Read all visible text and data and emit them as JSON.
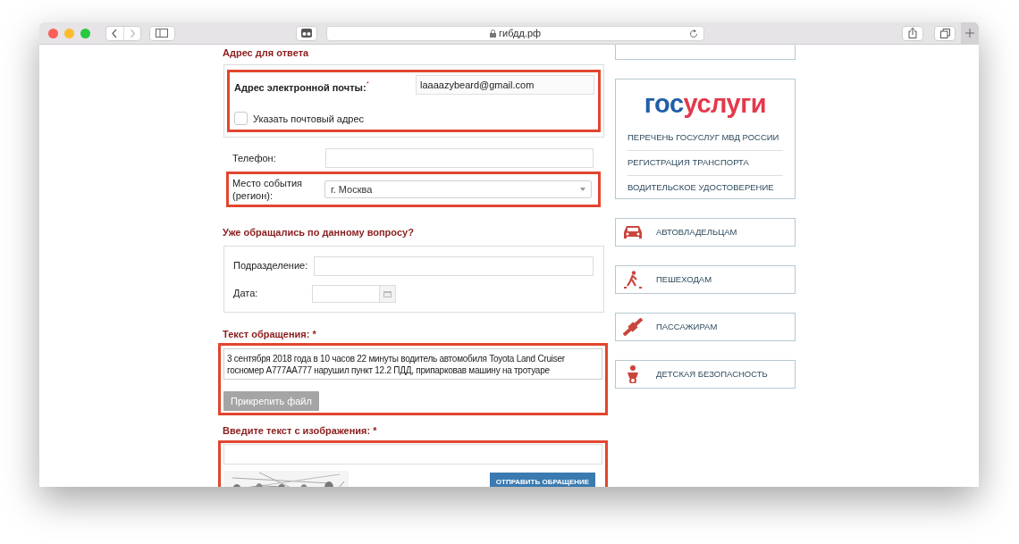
{
  "browser": {
    "address": "гибдд.рф"
  },
  "reply_address": {
    "heading": "Адрес для ответа",
    "highlighted": true,
    "email_label": "Адрес электронной почты:",
    "required_mark": "*",
    "email_value": "laaaazybeard@gmail.com",
    "postal_checkbox": {
      "label": "Указать почтовый адрес",
      "checked": false
    }
  },
  "phone": {
    "label": "Телефон:"
  },
  "region": {
    "label": "Место события (регион):",
    "value": "г. Москва",
    "highlighted": true
  },
  "previous": {
    "heading": "Уже обращались по данному вопросу?",
    "department_label": "Подразделение:",
    "date_label": "Дата:"
  },
  "appeal": {
    "heading": "Текст обращения: *",
    "text": "3 сентября 2018 года в 10 часов 22 минуты водитель автомобиля Toyota Land Cruiser госномер А777АА777 нарушил пункт 12.2 ПДД, припарковав машину на тротуаре",
    "attach_button": "Прикрепить файл",
    "highlighted": true
  },
  "captcha": {
    "heading": "Введите текст с изображения: *",
    "submit_button": "ОТПРАВИТЬ ОБРАЩЕНИЕ",
    "highlighted": true
  },
  "sidebar": {
    "logo": {
      "first": "гос",
      "second": "услуги"
    },
    "links": [
      "ПЕРЕЧЕНЬ ГОСУСЛУГ МВД РОССИИ",
      "РЕГИСТРАЦИЯ ТРАНСПОРТА",
      "ВОДИТЕЛЬСКОЕ УДОСТОВЕРЕНИЕ"
    ],
    "sections": [
      {
        "label": "АВТОВЛАДЕЛЬЦАМ",
        "kind": "car"
      },
      {
        "label": "ПЕШЕХОДАМ",
        "kind": "pedestrian"
      },
      {
        "label": "ПАССАЖИРАМ",
        "kind": "seatbelt"
      },
      {
        "label": "ДЕТСКАЯ БЕЗОПАСНОСТЬ",
        "kind": "child"
      }
    ]
  }
}
